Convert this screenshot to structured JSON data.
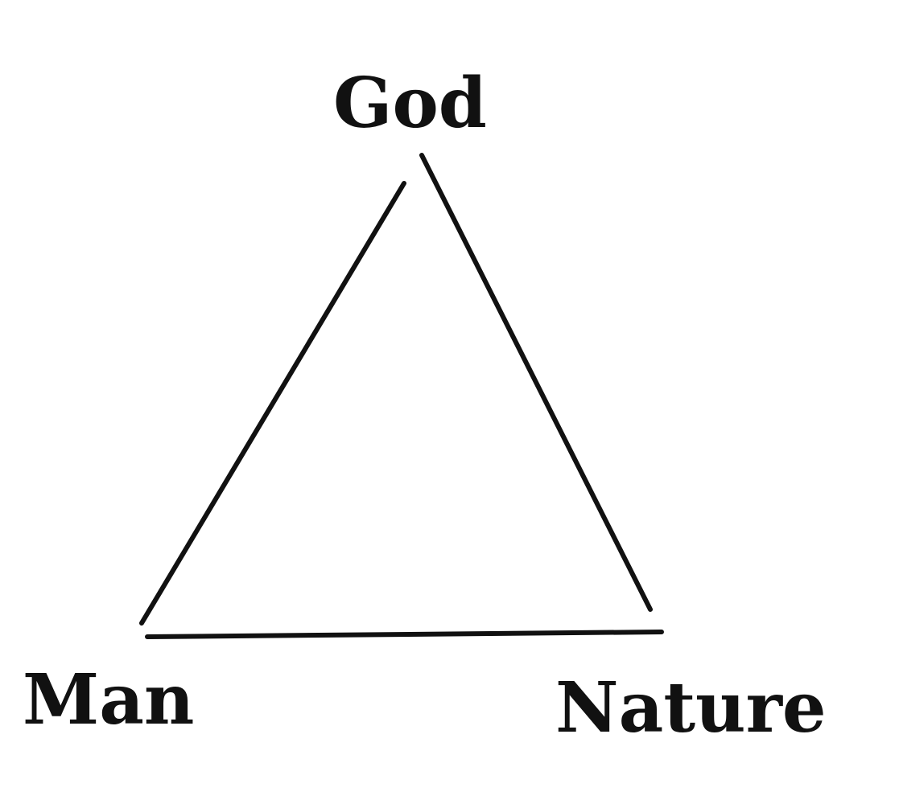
{
  "diagram": {
    "nodes": [
      {
        "id": "god",
        "label": "God"
      },
      {
        "id": "man",
        "label": "Man"
      },
      {
        "id": "nature",
        "label": "Nature"
      }
    ],
    "edges": [
      {
        "from": "god",
        "to": "man"
      },
      {
        "from": "god",
        "to": "nature"
      },
      {
        "from": "man",
        "to": "nature"
      }
    ],
    "line_color": "#111111"
  }
}
